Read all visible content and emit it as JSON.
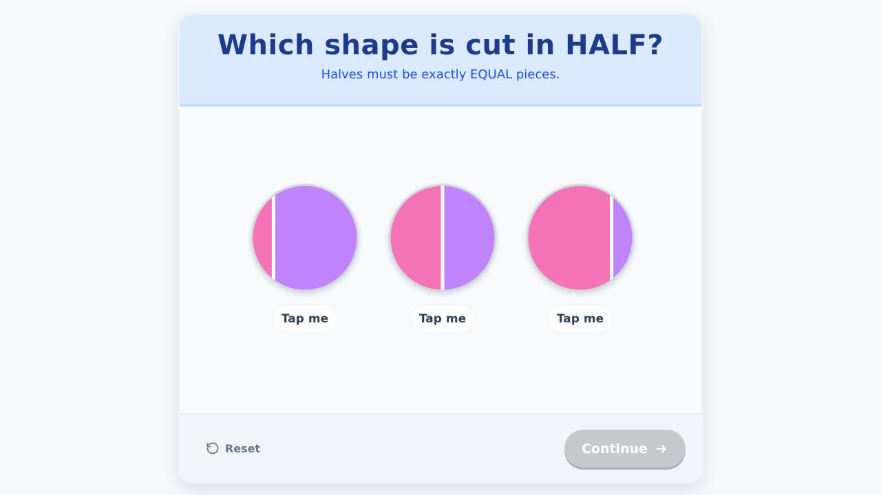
{
  "header": {
    "title": "Which shape is cut in HALF?",
    "subtitle": "Halves must be exactly EQUAL pieces."
  },
  "options": [
    {
      "tap_label": "Tap me",
      "left_share": 0.2,
      "equal_halves": false
    },
    {
      "tap_label": "Tap me",
      "left_share": 0.5,
      "equal_halves": true
    },
    {
      "tap_label": "Tap me",
      "left_share": 0.8,
      "equal_halves": false
    }
  ],
  "footer": {
    "reset_label": "Reset",
    "continue_label": "Continue",
    "continue_enabled": false
  },
  "colors": {
    "left_piece": "#f472b6",
    "right_piece": "#c084fc",
    "cut_line": "#ffffff",
    "outline": "#d4d7de",
    "continue_disabled": "#c6c8cc"
  },
  "icons": {
    "reset": "rotate-ccw-icon",
    "continue": "arrow-right-icon"
  }
}
